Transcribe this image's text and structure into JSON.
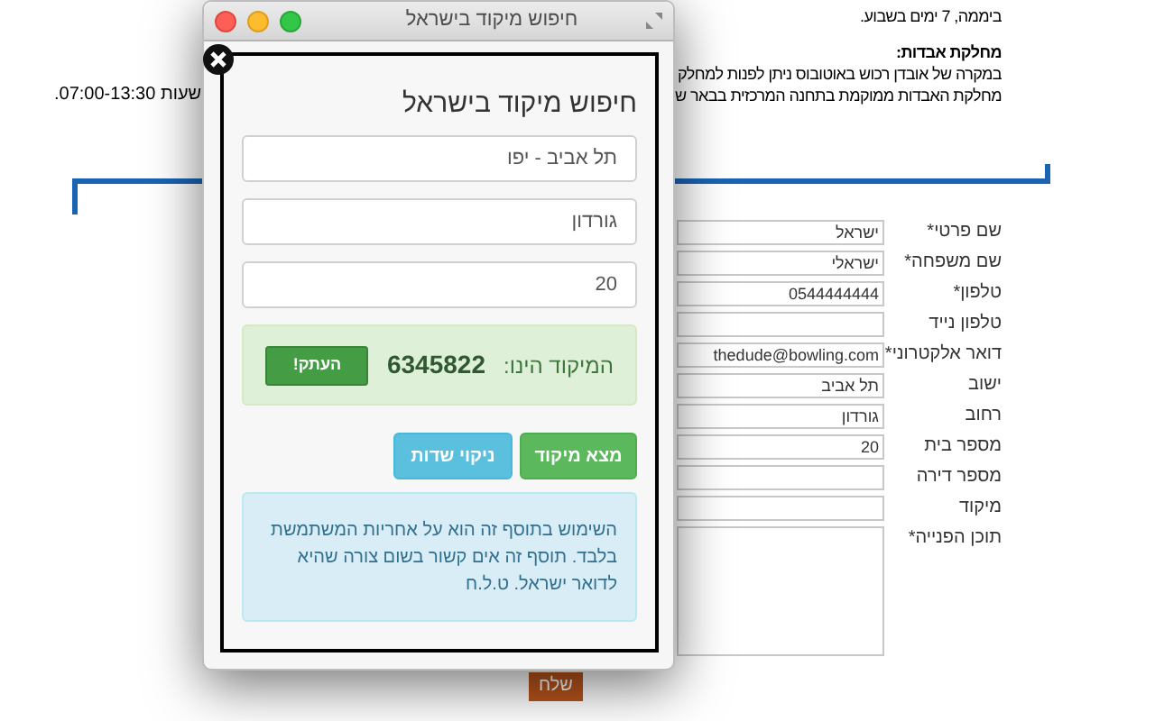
{
  "page": {
    "lines": [
      {
        "text": "ביממה, 7 ימים בשבוע.",
        "kind": "plain"
      },
      {
        "text": "מחלקת אבדות:",
        "kind": "heading"
      },
      {
        "text": "במקרה של אובדן רכוש באוטובוס ניתן לפנות למחלק",
        "kind": "plain"
      },
      {
        "text": "מחלקת האבדות ממוקמת בתחנה המרכזית בבאר ש",
        "kind": "plain"
      }
    ],
    "side_fragment": "שעות 07:00-13:30."
  },
  "form": {
    "fields": [
      {
        "label": "שם פרטי*",
        "value": "ישראל",
        "kind": "input"
      },
      {
        "label": "שם משפחה*",
        "value": "ישראלי",
        "kind": "input"
      },
      {
        "label": "טלפון*",
        "value": "0544444444",
        "kind": "input"
      },
      {
        "label": "טלפון נייד",
        "kind": "input"
      },
      {
        "label": "דואר אלקטרוני*",
        "value": "thedude@bowling.com",
        "kind": "input"
      },
      {
        "label": "ישוב",
        "value": "תל אביב",
        "kind": "input"
      },
      {
        "label": "רחוב",
        "value": "גורדון",
        "kind": "input"
      },
      {
        "label": "מספר בית",
        "value": "20",
        "kind": "input"
      },
      {
        "label": "מספר דירה",
        "kind": "input"
      },
      {
        "label": "מיקוד",
        "kind": "input"
      },
      {
        "label": "תוכן הפנייה*",
        "kind": "textarea"
      }
    ],
    "submit": "שלח"
  },
  "popup": {
    "window_title": "חיפוש מיקוד בישראל",
    "heading": "חיפוש מיקוד בישראל",
    "inputs": [
      "תל אביב - יפו",
      "גורדון",
      "20"
    ],
    "result": {
      "label": "המיקוד הינו:",
      "code": "6345822",
      "copy_button": "העתק!"
    },
    "buttons": [
      {
        "label": "מצא מיקוד",
        "kind": "success"
      },
      {
        "label": "ניקוי שדות",
        "kind": "info"
      }
    ],
    "notice": "השימוש בתוסף זה הוא על אחריות המשתמשת בלבד. תוסף זה אים קשור בשום צורה שהיא לדואר ישראל. ט.ל.ח"
  }
}
